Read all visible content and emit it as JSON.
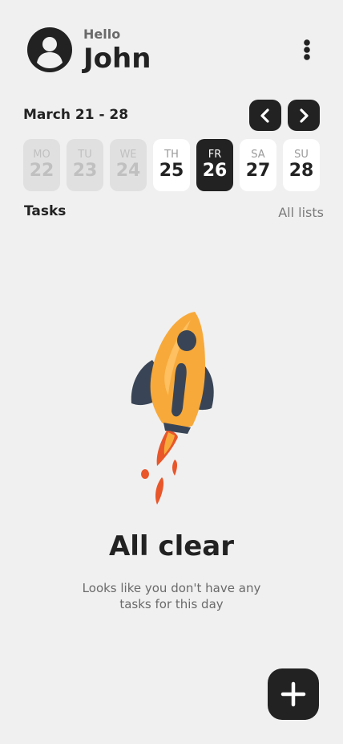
{
  "header": {
    "greeting": "Hello",
    "name": "John",
    "avatar_icon": "user-avatar-icon",
    "menu_icon": "more-vertical-icon"
  },
  "date_range": {
    "label": "March 21 - 28",
    "prev_icon": "chevron-left-icon",
    "next_icon": "chevron-right-icon"
  },
  "days": [
    {
      "name": "MO",
      "date": "22",
      "state": "past"
    },
    {
      "name": "TU",
      "date": "23",
      "state": "past"
    },
    {
      "name": "WE",
      "date": "24",
      "state": "past"
    },
    {
      "name": "TH",
      "date": "25",
      "state": "future"
    },
    {
      "name": "FR",
      "date": "26",
      "state": "active"
    },
    {
      "name": "SA",
      "date": "27",
      "state": "future"
    },
    {
      "name": "SU",
      "date": "28",
      "state": "future"
    }
  ],
  "tasks": {
    "title": "Tasks",
    "all_lists": "All lists"
  },
  "empty_state": {
    "illustration": "rocket-icon",
    "title": "All clear",
    "subtitle": "Looks like you don't have any tasks for this day"
  },
  "fab": {
    "icon": "plus-icon"
  },
  "colors": {
    "background": "#f0f0f0",
    "dark": "#222222",
    "rocket_body": "#f7a93a",
    "rocket_dark": "#394556",
    "flame": "#e8562a"
  }
}
